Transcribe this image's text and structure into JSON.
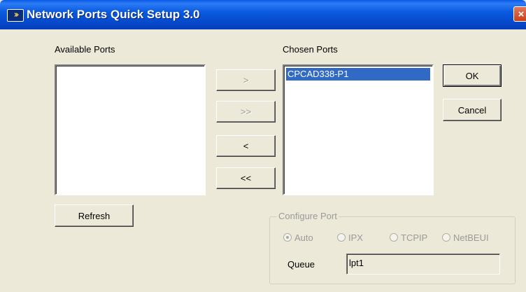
{
  "window": {
    "title": "Network Ports Quick Setup 3.0",
    "icon": "double-chevron-icon",
    "close_label": "×"
  },
  "available": {
    "label": "Available Ports",
    "items": []
  },
  "chosen": {
    "label": "Chosen Ports",
    "items": [
      "CPCAD338-P1"
    ]
  },
  "move_buttons": {
    "add_one": ">",
    "add_all": ">>",
    "remove_one": "<",
    "remove_all": "<<"
  },
  "buttons": {
    "ok": "OK",
    "cancel": "Cancel",
    "refresh": "Refresh"
  },
  "configure": {
    "title": "Configure Port",
    "protocols": [
      {
        "label": "Auto",
        "selected": true
      },
      {
        "label": "IPX",
        "selected": false
      },
      {
        "label": "TCPIP",
        "selected": false
      },
      {
        "label": "NetBEUI",
        "selected": false
      }
    ],
    "queue_label": "Queue",
    "queue_value": "lpt1"
  },
  "colors": {
    "titlebar": "#0A5AE0",
    "selection": "#316AC5",
    "dialog_bg": "#ECE9D8"
  }
}
